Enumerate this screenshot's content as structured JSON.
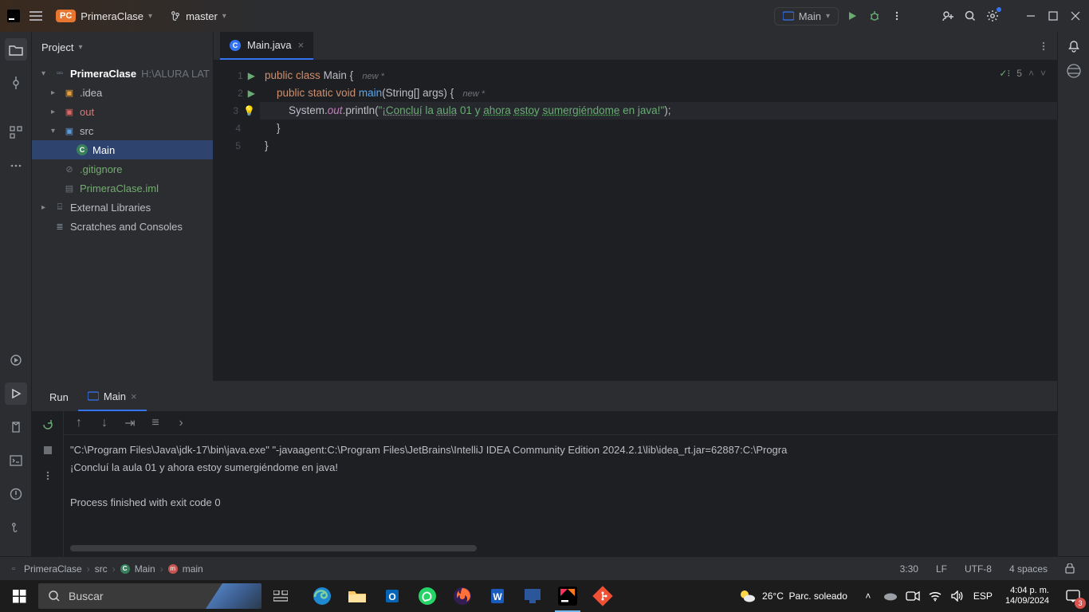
{
  "titlebar": {
    "pill": "PC",
    "project": "PrimeraClase",
    "branch": "master",
    "runconfig": "Main"
  },
  "project_tool": {
    "title": "Project",
    "root": "PrimeraClase",
    "root_path": "H:\\ALURA LAT",
    "items": {
      "idea": ".idea",
      "out": "out",
      "src": "src",
      "main": "Main",
      "gitignore": ".gitignore",
      "iml": "PrimeraClase.iml",
      "ext": "External Libraries",
      "scratch": "Scratches and Consoles"
    }
  },
  "editor": {
    "tab": "Main.java",
    "problems": "5",
    "lines": {
      "l1": {
        "n": "1"
      },
      "l2": {
        "n": "2",
        "tag": "new *"
      },
      "l3": {
        "n": "3"
      },
      "l4": {
        "n": "4"
      },
      "l5": {
        "n": "5"
      }
    },
    "code": {
      "kw_public": "public",
      "kw_class": "class",
      "cls": "Main",
      "brace_o": "{",
      "tag_new": "new *",
      "kw_static": "static",
      "kw_void": "void",
      "fn_main": "main",
      "params": "(String[] args)",
      "sys": "System.",
      "out": "out",
      "println": ".println(",
      "str_open": "\"¡",
      "w1": "Concluí",
      "sp1": " la ",
      "w2": "aula",
      "sp2": " 01 y ",
      "w3": "ahora",
      "sp3": " ",
      "w4": "estoy",
      "sp4": " ",
      "w5": "sumergiéndome",
      "sp5": " en java!",
      "str_close": "\"",
      ");": ");",
      "brace_c_inner": "    }",
      "brace_c": "}"
    }
  },
  "run": {
    "label": "Run",
    "tab": "Main",
    "lines": [
      "\"C:\\Program Files\\Java\\jdk-17\\bin\\java.exe\" \"-javaagent:C:\\Program Files\\JetBrains\\IntelliJ IDEA Community Edition 2024.2.1\\lib\\idea_rt.jar=62887:C:\\Progra",
      "¡Concluí la aula 01 y ahora estoy sumergiéndome en java!",
      "",
      "Process finished with exit code 0"
    ]
  },
  "breadcrumb": {
    "p": "PrimeraClase",
    "src": "src",
    "main": "Main",
    "method": "main"
  },
  "status": {
    "pos": "3:30",
    "le": "LF",
    "enc": "UTF-8",
    "indent": "4 spaces"
  },
  "taskbar": {
    "search_placeholder": "Buscar",
    "weather_temp": "26°C",
    "weather_desc": "Parc. soleado",
    "lang": "ESP",
    "time": "4:04 p. m.",
    "date": "14/09/2024",
    "notif": "3"
  }
}
